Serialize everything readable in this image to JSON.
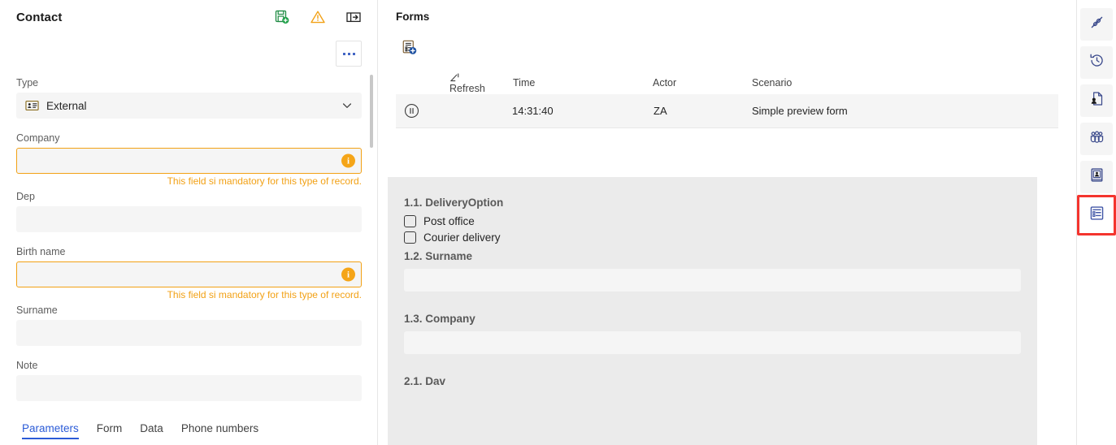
{
  "left_panel": {
    "title": "Contact",
    "header_icons": [
      {
        "name": "save-and-close-icon",
        "label": "Save"
      },
      {
        "name": "warning-icon",
        "label": "Warning"
      },
      {
        "name": "expand-panel-icon",
        "label": "Expand panel"
      }
    ],
    "more_button_label": "...",
    "fields": [
      {
        "label": "Type",
        "value": "External",
        "type": "combobox",
        "icon": "id-card-icon",
        "invalid": false,
        "validation": ""
      },
      {
        "label": "Company",
        "value": "",
        "type": "text",
        "invalid": true,
        "validation": "This field si mandatory for this type of record."
      },
      {
        "label": "Dep",
        "value": "",
        "type": "text",
        "invalid": false,
        "validation": ""
      },
      {
        "label": "Birth name",
        "value": "",
        "type": "text",
        "invalid": true,
        "validation": "This field si mandatory for this type of record."
      },
      {
        "label": "Surname",
        "value": "",
        "type": "text",
        "invalid": false,
        "validation": ""
      },
      {
        "label": "Note",
        "value": "",
        "type": "text",
        "invalid": false,
        "validation": ""
      }
    ],
    "tabs": [
      {
        "label": "Parameters",
        "active": true
      },
      {
        "label": "Form",
        "active": false
      },
      {
        "label": "Data",
        "active": false
      },
      {
        "label": "Phone numbers",
        "active": false
      }
    ]
  },
  "main_panel": {
    "title": "Forms",
    "toolbar": {
      "new_form_icon": "new-form-icon"
    },
    "grid": {
      "columns": [
        "",
        "Refresh",
        "Time",
        "Actor",
        "Scenario"
      ],
      "rows": [
        {
          "status_icon": "pause-circle-icon",
          "time": "14:31:40",
          "actor": "ZA",
          "scenario": "Simple preview form"
        }
      ]
    },
    "preview_form": {
      "items": [
        {
          "label": "1.1. DeliveryOption",
          "type": "checkbox-group",
          "options": [
            {
              "label": "Post office",
              "checked": false
            },
            {
              "label": "Courier delivery",
              "checked": false
            }
          ]
        },
        {
          "label": "1.2. Surname",
          "type": "text",
          "value": ""
        },
        {
          "label": "1.3. Company",
          "type": "text",
          "value": ""
        },
        {
          "label": "2.1. Dav",
          "type": "cut-off-label"
        }
      ]
    }
  },
  "right_rail": {
    "items": [
      {
        "name": "connector-icon",
        "selected": false
      },
      {
        "name": "history-icon",
        "selected": false
      },
      {
        "name": "document-person-icon",
        "selected": false
      },
      {
        "name": "group-people-icon",
        "selected": false
      },
      {
        "name": "contact-card-icon",
        "selected": false
      },
      {
        "name": "forms-list-icon",
        "selected": true
      }
    ]
  },
  "colors": {
    "accent_blue": "#2b5bd7",
    "warning_amber": "#f2a115",
    "badge_orange": "#f5a518",
    "highlight_red": "#f4342e",
    "field_bg": "#f5f5f5",
    "preview_bg": "#ebebeb",
    "icon_navy": "#3b4a8c"
  }
}
